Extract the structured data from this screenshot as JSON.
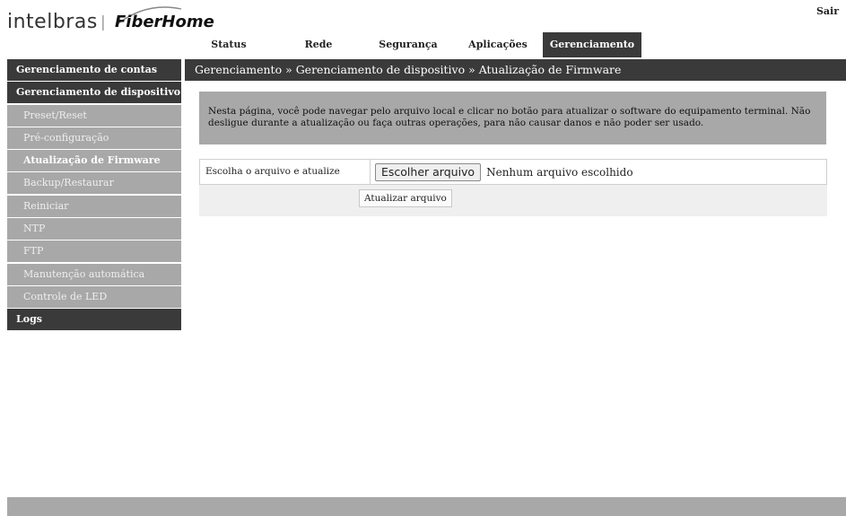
{
  "header": {
    "brand_intelbras": "intelbras",
    "brand_separator": "|",
    "brand_fiberhome": "FiberHome",
    "logout": "Sair"
  },
  "topnav": {
    "tabs": [
      {
        "label": "Status"
      },
      {
        "label": "Rede"
      },
      {
        "label": "Segurança"
      },
      {
        "label": "Aplicações"
      },
      {
        "label": "Gerenciamento",
        "active": true
      }
    ]
  },
  "sidebar": {
    "items": [
      {
        "label": "Gerenciamento de contas",
        "level": "main"
      },
      {
        "label": "Gerenciamento de dispositivo",
        "level": "main"
      },
      {
        "label": "Preset/Reset",
        "level": "sub"
      },
      {
        "label": "Pré-configuração",
        "level": "sub"
      },
      {
        "label": "Atualização de Firmware",
        "level": "sub",
        "active": true
      },
      {
        "label": "Backup/Restaurar",
        "level": "sub"
      },
      {
        "label": "Reiniciar",
        "level": "sub"
      },
      {
        "label": "NTP",
        "level": "sub"
      },
      {
        "label": "FTP",
        "level": "sub"
      },
      {
        "label": "Manutenção automática",
        "level": "sub"
      },
      {
        "label": "Controle de LED",
        "level": "sub"
      },
      {
        "label": "Logs",
        "level": "main"
      }
    ]
  },
  "main": {
    "breadcrumb": "Gerenciamento » Gerenciamento de dispositivo » Atualização de Firmware",
    "info": "Nesta página, você pode navegar pelo arquivo local e clicar no botão para atualizar o software do equipamento terminal. Não desligue durante a atualização ou faça outras operações, para não causar danos e não poder ser usado.",
    "upload_label": "Escolha o arquivo e atualize",
    "choose_file_button": "Escolher arquivo",
    "no_file_text": "Nenhum arquivo escolhido",
    "update_button": "Atualizar arquivo"
  },
  "colors": {
    "dark_bar": "#3a3a3a",
    "grey_panel": "#a8a8a8",
    "light_panel": "#efefef"
  }
}
